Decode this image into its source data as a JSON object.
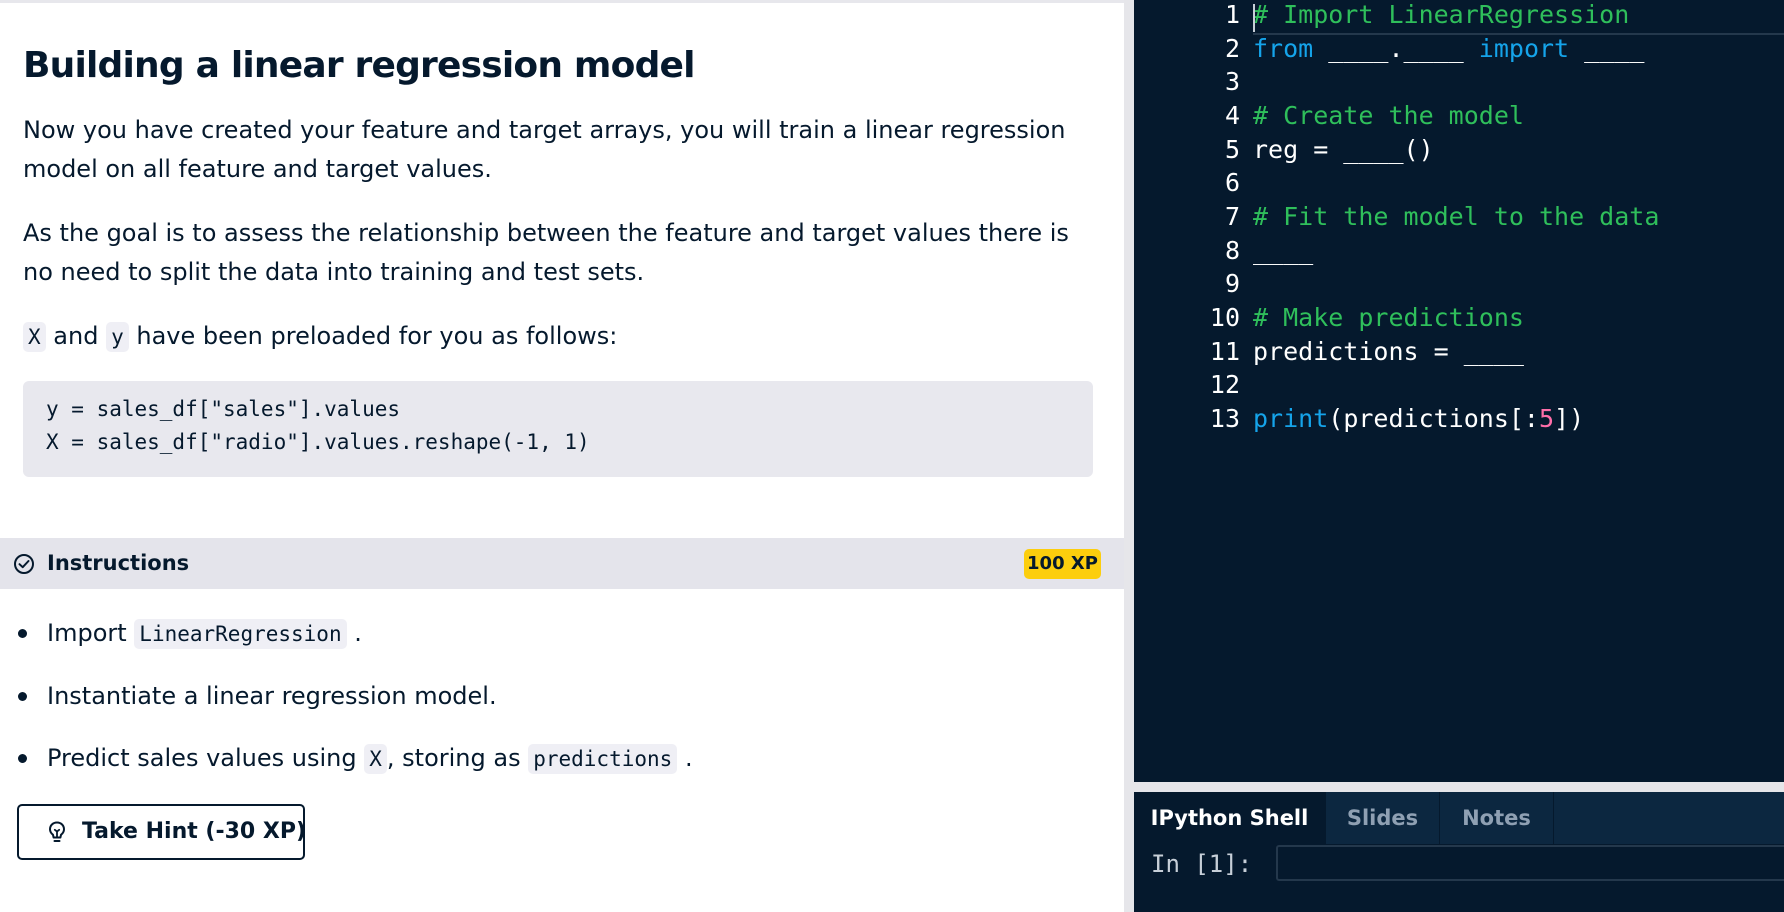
{
  "exercise": {
    "title": "Building a linear regression model",
    "paragraph1": "Now you have created your feature and target arrays, you will train a linear regression model on all feature and target values.",
    "paragraph2": "As the goal is to assess the relationship between the feature and target values there is no need to split the data into training and test sets.",
    "p3_code_x": "X",
    "p3_and": "and",
    "p3_code_y": "y",
    "p3_rest": "have been preloaded for you as follows:",
    "code_lines": [
      "y = sales_df[\"sales\"].values",
      "X = sales_df[\"radio\"].values.reshape(-1, 1)"
    ]
  },
  "instructions": {
    "label": "Instructions",
    "xp": "100 XP",
    "bullet1_pre": "Import",
    "bullet1_code": "LinearRegression",
    "bullet1_post": ".",
    "bullet2": "Instantiate a linear regression model.",
    "bullet3_pre": "Predict sales values using",
    "bullet3_code1": "X",
    "bullet3_mid": ", storing as",
    "bullet3_code2": "predictions",
    "bullet3_post": ".",
    "hint_button": "Take Hint (-30 XP)"
  },
  "editor": {
    "line_numbers": [
      "1",
      "2",
      "3",
      "4",
      "5",
      "6",
      "7",
      "8",
      "9",
      "10",
      "11",
      "12",
      "13"
    ],
    "l1": "# Import LinearRegression",
    "l2_kw1": "from",
    "l2_mid": " ____.____ ",
    "l2_kw2": "import",
    "l2_end": " ____",
    "l4": "# Create the model",
    "l5": "reg = ____()",
    "l7": "# Fit the model to the data",
    "l8": "____",
    "l10": "# Make predictions",
    "l11": "predictions = ____",
    "l13_fn": "print",
    "l13_a": "(predictions[:",
    "l13_num": "5",
    "l13_b": "])"
  },
  "shell": {
    "tabs": [
      "IPython Shell",
      "Slides",
      "Notes"
    ],
    "active_tab": "IPython Shell",
    "prompt": "In [1]:"
  },
  "colors": {
    "editor_bg": "#05192d",
    "comment": "#2fbf5b",
    "keyword": "#15a4ea",
    "number": "#ff6ea9",
    "xp_badge": "#fcce0d"
  }
}
